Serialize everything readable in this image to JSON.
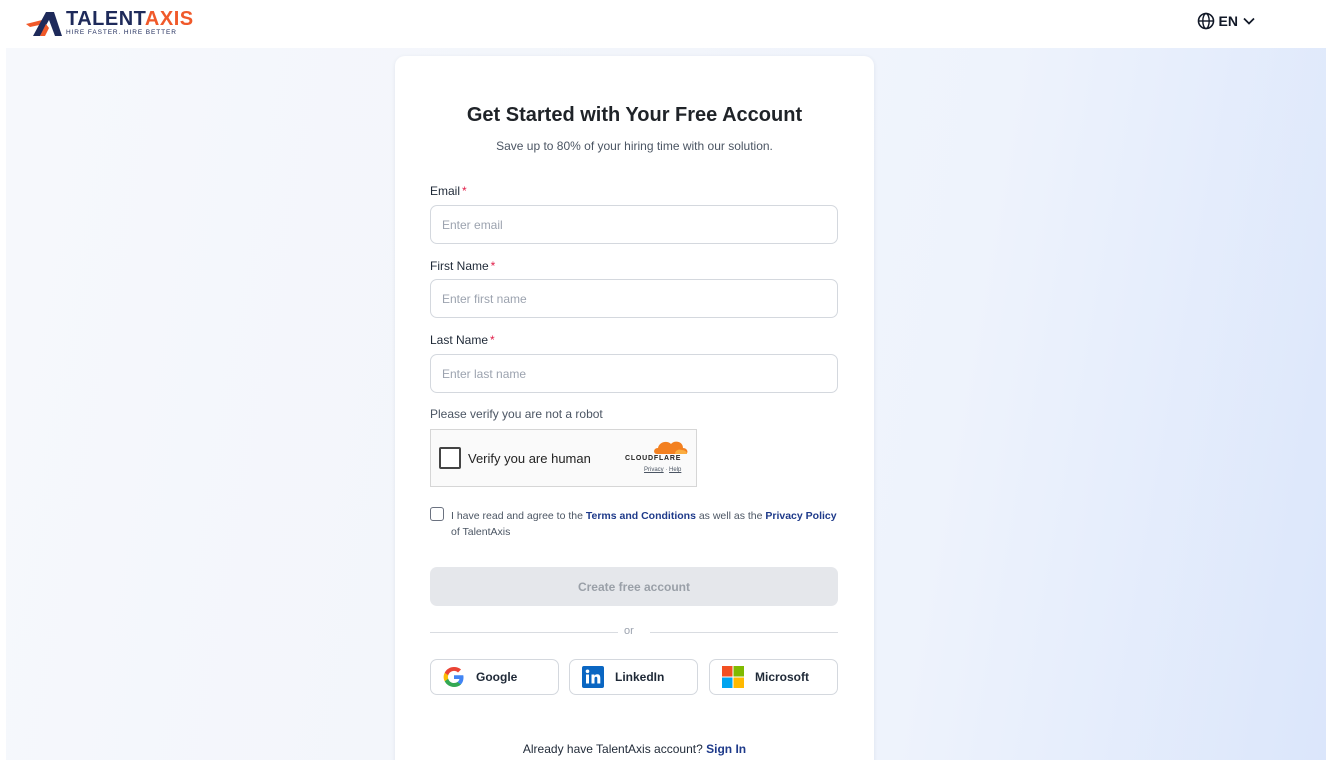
{
  "header": {
    "logo_word_main": "TALENT",
    "logo_word_accent": "AXIS",
    "logo_tagline": "HIRE FASTER. HIRE BETTER",
    "language": "EN"
  },
  "form": {
    "title": "Get Started with Your Free Account",
    "subtitle": "Save up to 80% of your hiring time with our solution.",
    "required_mark": "*",
    "email_label": "Email",
    "email_placeholder": "Enter email",
    "first_name_label": "First Name",
    "first_name_placeholder": "Enter first name",
    "last_name_label": "Last Name",
    "last_name_placeholder": "Enter last name",
    "robot_prompt": "Please verify you are not a robot",
    "captcha": {
      "label": "Verify you are human",
      "brand": "CLOUDFLARE",
      "privacy": "Privacy",
      "separator": " · ",
      "help": "Help"
    },
    "agree": {
      "prefix": "I have read and agree to the ",
      "terms": "Terms and Conditions",
      "middle": " as well as the ",
      "privacy": "Privacy Policy",
      "suffix": " of TalentAxis"
    },
    "create_button": "Create free account",
    "divider": "or",
    "social": [
      {
        "label": "Google",
        "icon": "google-icon"
      },
      {
        "label": "LinkedIn",
        "icon": "linkedin-icon"
      },
      {
        "label": "Microsoft",
        "icon": "microsoft-icon"
      }
    ],
    "signin_prompt": "Already have TalentAxis account? ",
    "signin_link": "Sign In"
  },
  "colors": {
    "brand_navy": "#1e2a5a",
    "brand_orange": "#f0592a",
    "link": "#1e3a8a",
    "required": "#e11d48"
  }
}
